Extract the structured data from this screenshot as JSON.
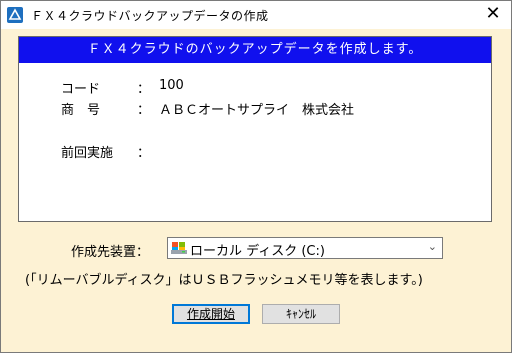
{
  "window": {
    "title": "ＦＸ４クラウドバックアップデータの作成",
    "close_glyph": "✕"
  },
  "panel": {
    "banner": "ＦＸ４クラウドのバックアップデータを作成します。",
    "rows": [
      {
        "label": "コード",
        "colon": "：",
        "value": "100"
      },
      {
        "label": "商　号",
        "colon": "：",
        "value": "ＡＢＣオートサプライ　株式会社"
      },
      {
        "label": "前回実施",
        "colon": "：",
        "value": ""
      }
    ]
  },
  "destination": {
    "label": "作成先装置：",
    "selected": "ローカル ディスク (C:)",
    "icon": "drive-icon"
  },
  "note": "(「リムーバブルディスク」はＵＳＢフラッシュメモリ等を表します。)",
  "buttons": {
    "start": "作成開始",
    "cancel": "ｷｬﾝｾﾙ"
  },
  "colors": {
    "banner_bg": "#1010ee",
    "window_bg": "#fdf2d4",
    "focus_border": "#0078d7"
  }
}
